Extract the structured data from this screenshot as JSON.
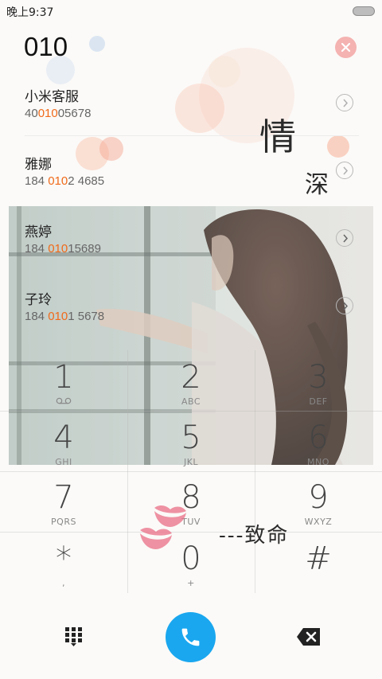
{
  "status_bar": {
    "time": "晚上9:37"
  },
  "dialer": {
    "number": "010"
  },
  "contacts": [
    {
      "name": "小米客服",
      "number_pre": "40",
      "number_match": "010",
      "number_post": "05678"
    },
    {
      "name": "雅娜",
      "number_pre": "184 ",
      "number_match": "010",
      "number_post": "2 4685"
    },
    {
      "name": "燕婷",
      "number_pre": "184 ",
      "number_match": "010",
      "number_post": "15689"
    },
    {
      "name": "子玲",
      "number_pre": "184 ",
      "number_match": "010",
      "number_post": "1 5678"
    }
  ],
  "keypad": [
    {
      "digit": "1",
      "letters": ""
    },
    {
      "digit": "2",
      "letters": "ABC"
    },
    {
      "digit": "3",
      "letters": "DEF"
    },
    {
      "digit": "4",
      "letters": "GHI"
    },
    {
      "digit": "5",
      "letters": "JKL"
    },
    {
      "digit": "6",
      "letters": "MNO"
    },
    {
      "digit": "7",
      "letters": "PQRS"
    },
    {
      "digit": "8",
      "letters": "TUV"
    },
    {
      "digit": "9",
      "letters": "WXYZ"
    },
    {
      "digit": "*",
      "letters": ","
    },
    {
      "digit": "0",
      "letters": "+"
    },
    {
      "digit": "#",
      "letters": ""
    }
  ],
  "decoration": {
    "text_1": "情",
    "text_2": "深",
    "signature": "---致命"
  },
  "icons": {
    "clear": "clear-circle-icon",
    "detail": "chevron-right-circle-icon",
    "voicemail": "voicemail-icon",
    "keypad": "dialpad-icon",
    "call": "phone-icon",
    "backspace": "backspace-icon"
  },
  "colors": {
    "accent_call": "#1aa7ef",
    "match_highlight": "#f06a1a",
    "clear_button": "#f4b2b0"
  }
}
